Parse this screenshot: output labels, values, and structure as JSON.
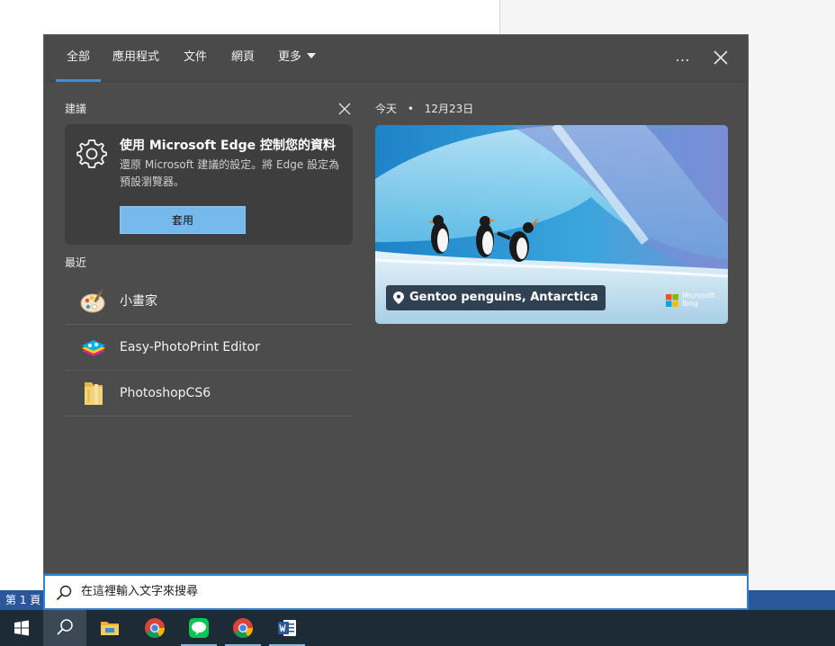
{
  "word": {
    "page_indicator": "第 1 頁"
  },
  "tabs": [
    {
      "label": "全部",
      "active": true
    },
    {
      "label": "應用程式"
    },
    {
      "label": "文件"
    },
    {
      "label": "網頁"
    },
    {
      "label": "更多"
    }
  ],
  "tab_actions": {
    "more_icon": "…",
    "close_icon": "close-icon"
  },
  "suggestion": {
    "section_label": "建議",
    "title": "使用 Microsoft Edge 控制您的資料",
    "description": "還原 Microsoft 建議的設定。將 Edge 設定為預設瀏覽器。",
    "button_label": "套用",
    "icon": "gear-icon"
  },
  "recent": {
    "section_label": "最近",
    "items": [
      {
        "name": "小畫家",
        "icon": "paint-palette-icon"
      },
      {
        "name": "Easy-PhotoPrint Editor",
        "icon": "photoprint-icon"
      },
      {
        "name": "PhotoshopCS6",
        "icon": "folder-icon"
      }
    ]
  },
  "today": {
    "label": "今天",
    "separator": "•",
    "date": "12月23日",
    "caption": "Gentoo penguins, Antarctica",
    "brand_line1": "Microsoft",
    "brand_line2": "Bing"
  },
  "search": {
    "placeholder": "在這裡輸入文字來搜尋"
  },
  "taskbar": {
    "items": [
      "start-icon",
      "search-icon",
      "file-explorer-icon",
      "chrome-icon",
      "line-icon",
      "chrome-icon",
      "word-icon"
    ]
  },
  "colors": {
    "accent": "#3e8be0",
    "panel": "#4c4c4c",
    "button": "#76b9ed",
    "taskbar": "#1d2b36"
  }
}
